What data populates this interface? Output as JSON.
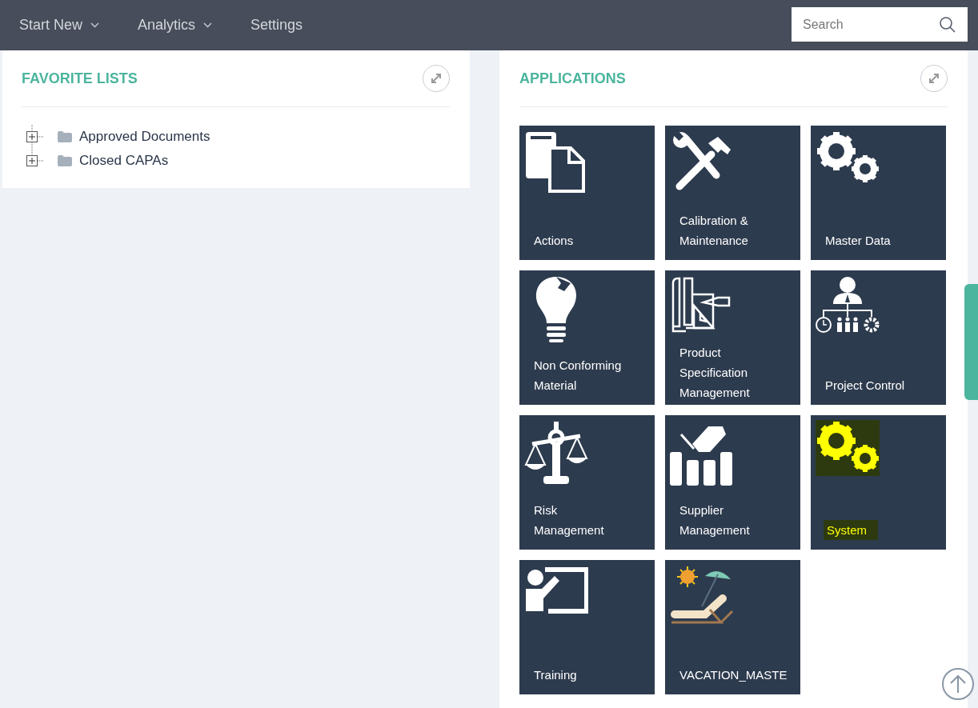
{
  "nav": {
    "items": [
      {
        "label": "Start New",
        "dropdown": true
      },
      {
        "label": "Analytics",
        "dropdown": true
      },
      {
        "label": "Settings",
        "dropdown": false
      }
    ],
    "search": {
      "placeholder": "Search"
    }
  },
  "favorite_lists": {
    "title": "FAVORITE LISTS",
    "items": [
      {
        "label": "Approved Documents",
        "expanded": false
      },
      {
        "label": "Closed CAPAs",
        "expanded": false
      }
    ]
  },
  "applications": {
    "title": "APPLICATIONS",
    "tiles": [
      {
        "label": "Actions",
        "kind": "documents",
        "highlighted": false
      },
      {
        "label": "Calibration &\nMaintenance",
        "kind": "tools",
        "highlighted": false
      },
      {
        "label": "Master Data",
        "kind": "gears",
        "highlighted": false
      },
      {
        "label": "Non Conforming\nMaterial",
        "kind": "bulb",
        "highlighted": false
      },
      {
        "label": "Product\nSpecification\nManagement",
        "kind": "blueprint",
        "highlighted": false
      },
      {
        "label": "Project Control",
        "kind": "org",
        "highlighted": false
      },
      {
        "label": "Risk\nManagement",
        "kind": "scale",
        "highlighted": false
      },
      {
        "label": "Supplier\nManagement",
        "kind": "handshake",
        "highlighted": false
      },
      {
        "label": "System",
        "kind": "gears",
        "highlighted": true
      },
      {
        "label": "Training",
        "kind": "training",
        "highlighted": false
      },
      {
        "label": "VACATION_MASTE",
        "kind": "vacation",
        "highlighted": false
      }
    ]
  }
}
